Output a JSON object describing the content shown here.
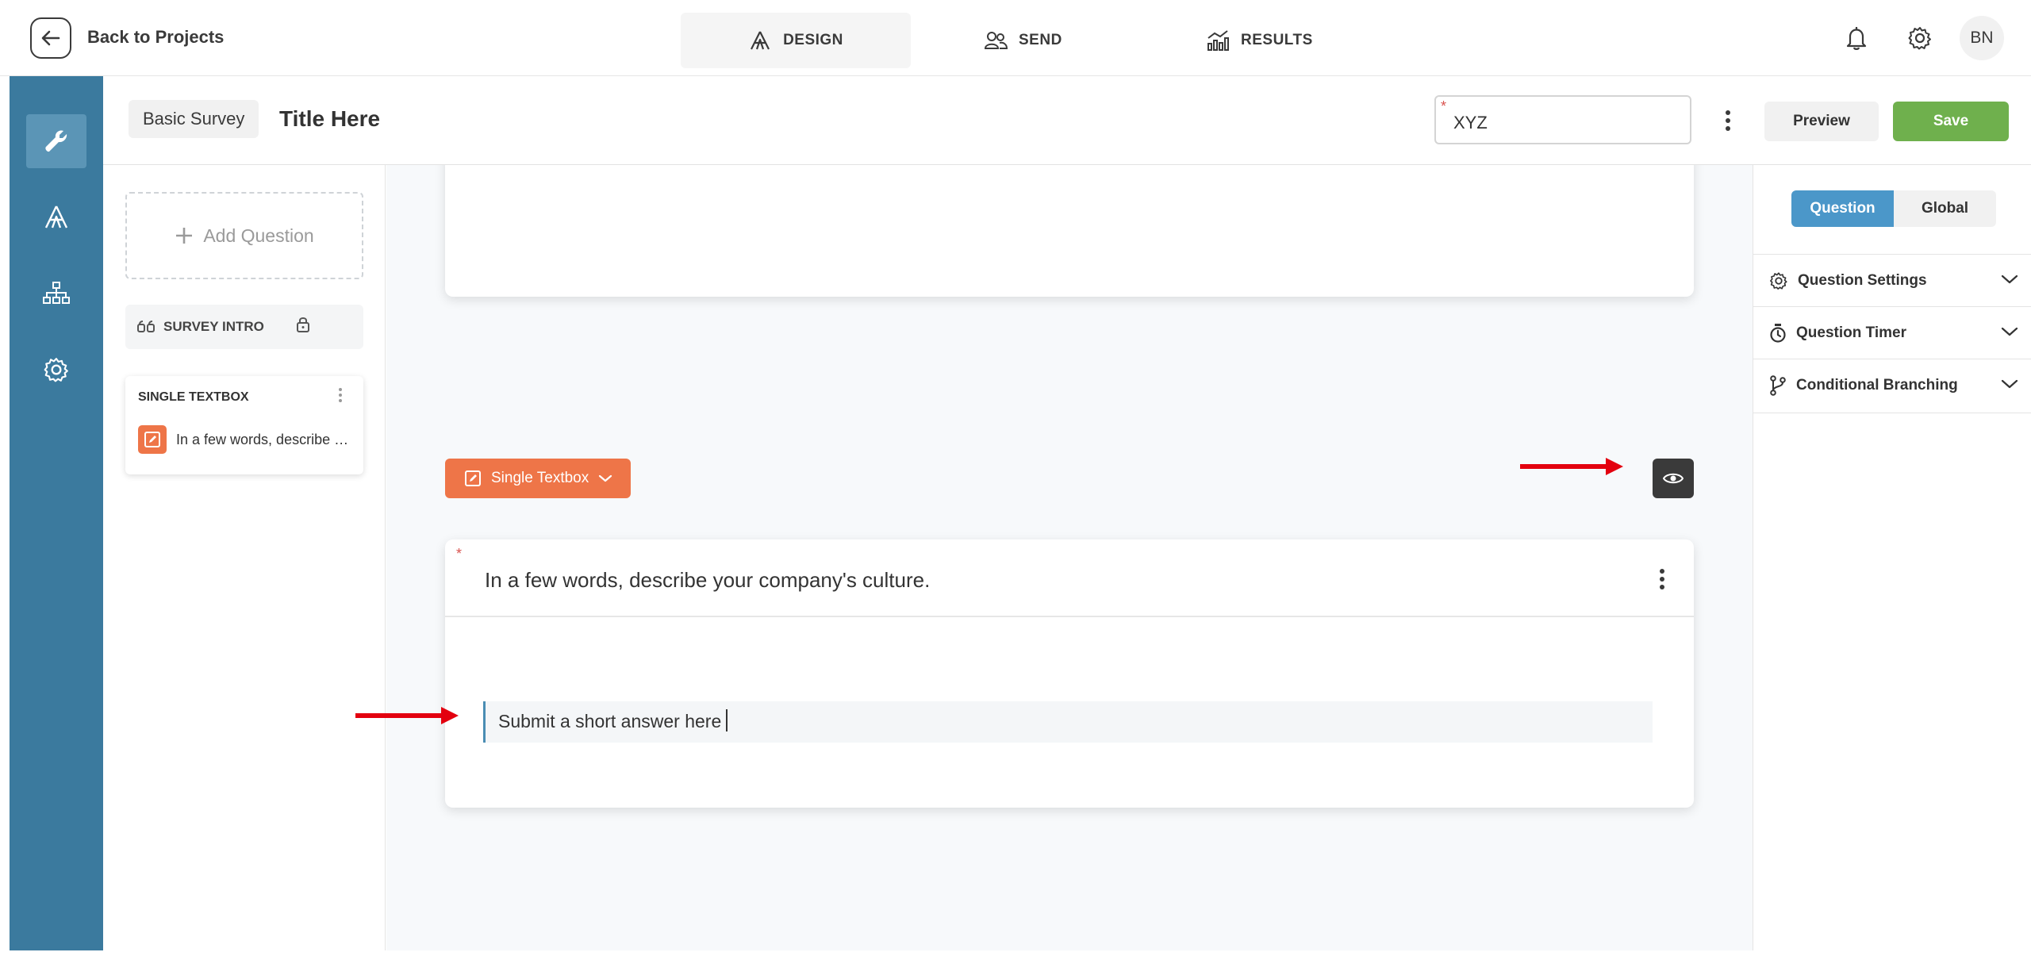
{
  "topbar": {
    "back_label": "Back to Projects",
    "tabs": [
      {
        "label": "DESIGN",
        "icon": "design-icon",
        "active": true
      },
      {
        "label": "SEND",
        "icon": "people-icon",
        "active": false
      },
      {
        "label": "RESULTS",
        "icon": "results-chart-icon",
        "active": false
      }
    ],
    "avatar_initials": "BN"
  },
  "rail": {
    "items": [
      {
        "icon": "wrench-icon",
        "active": true
      },
      {
        "icon": "design-icon",
        "active": false
      },
      {
        "icon": "sitemap-icon",
        "active": false
      },
      {
        "icon": "gear-icon",
        "active": false
      }
    ]
  },
  "subheader": {
    "survey_type": "Basic Survey",
    "title": "Title Here",
    "code_field_value": "XYZ",
    "code_field_required_mark": "*",
    "preview_label": "Preview",
    "save_label": "Save"
  },
  "questions_panel": {
    "add_question_label": "Add Question",
    "intro_label": "SURVEY INTRO",
    "question_cards": [
      {
        "type_label": "SINGLE TEXTBOX",
        "text": "In a few words, describe your company's culture."
      }
    ]
  },
  "canvas": {
    "question_type_label": "Single Textbox",
    "required_mark": "*",
    "question_text": "In a few words, describe your company's culture.",
    "answer_placeholder": "Submit a short answer here"
  },
  "right_panel": {
    "tabs": [
      {
        "label": "Question",
        "active": true
      },
      {
        "label": "Global",
        "active": false
      }
    ],
    "sections": [
      {
        "label": "Question Settings",
        "icon": "gear-icon"
      },
      {
        "label": "Question Timer",
        "icon": "timer-icon"
      },
      {
        "label": "Conditional Branching",
        "icon": "branch-icon"
      }
    ]
  },
  "colors": {
    "rail": "#3b7a9e",
    "accent_orange": "#ee7548",
    "save_green": "#6fb04d",
    "active_blue": "#4b97c9",
    "annotation_red": "#e3000f"
  }
}
